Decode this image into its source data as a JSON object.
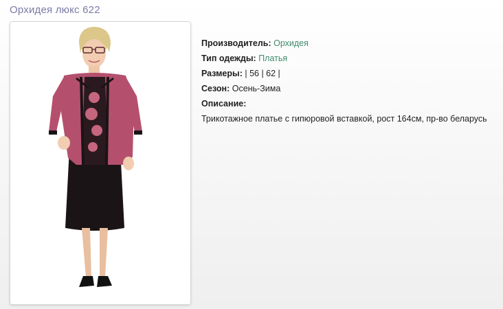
{
  "product": {
    "title": "Орхидея люкс 622"
  },
  "details": {
    "manufacturer_label": "Производитель:",
    "manufacturer_value": "Орхидея",
    "type_label": "Тип одежды:",
    "type_value": "Платья",
    "sizes_label": "Размеры:",
    "sizes_value": "| 56 | 62 |",
    "season_label": "Сезон:",
    "season_value": "Осень-Зима",
    "description_label": "Описание:",
    "description_text": "Трикотажное платье с гипюровой вставкой, рост 164см, пр-во беларусь"
  },
  "colors": {
    "title": "#7a7aa6",
    "link": "#3f8a6c",
    "jacket": "#b4506e",
    "dress": "#1b1416"
  },
  "icons": {
    "photo": "product-photo"
  }
}
